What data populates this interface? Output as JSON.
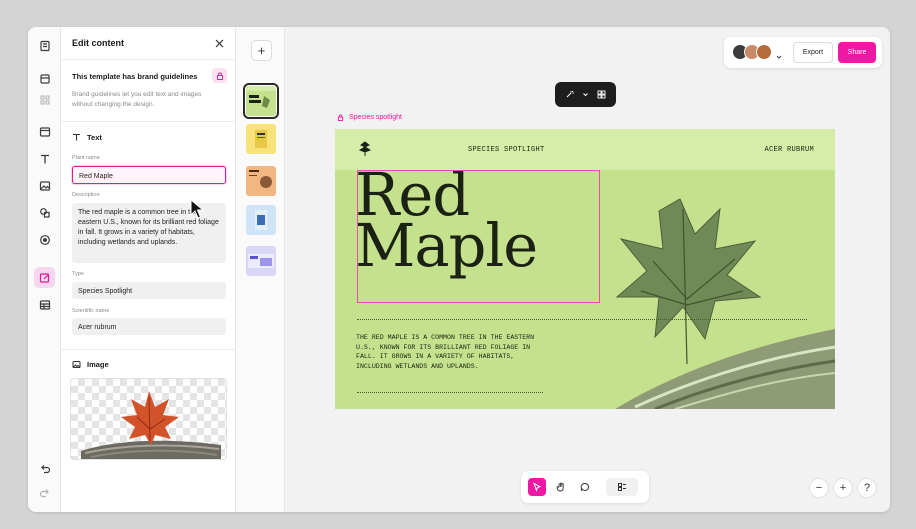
{
  "panel": {
    "title": "Edit content",
    "brand_title": "This template has brand guidelines",
    "brand_desc": "Brand guidelines let you edit text and images without changing the design.",
    "text_section": "Text",
    "fields": {
      "plant_name_label": "Plant name",
      "plant_name_value": "Red Maple",
      "description_label": "Description",
      "description_value": "The red maple is a common tree in the eastern U.S., known for its brilliant red foliage in fall. It grows in a variety of habitats, including wetlands and uplands.",
      "type_label": "Type",
      "type_value": "Species Spotlight",
      "scientific_label": "Scientific name",
      "scientific_value": "Acer rubrum"
    },
    "image_section": "Image"
  },
  "topbar": {
    "export_label": "Export",
    "share_label": "Share",
    "avatars": [
      "avatar-1",
      "avatar-2",
      "avatar-3"
    ]
  },
  "frame": {
    "label": "Species spotlight"
  },
  "slide": {
    "header_title": "SPECIES SPOTLIGHT",
    "header_sci": "ACER RUBRUM",
    "headline_line1": "Red",
    "headline_line2": "Maple",
    "description": "THE RED MAPLE IS A COMMON TREE IN THE EASTERN U.S., KNOWN FOR ITS BRILLIANT RED FOLIAGE IN FALL. IT GROWS IN A VARIETY OF HABITATS, INCLUDING WETLANDS AND UPLANDS."
  },
  "colors": {
    "accent": "#ef18a4",
    "slide_bg": "#c4e18e",
    "slide_header": "#d6eca9"
  }
}
